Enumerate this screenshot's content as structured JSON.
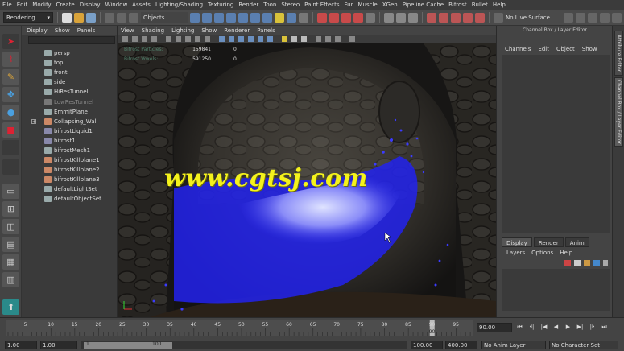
{
  "menubar": {
    "items": [
      "File",
      "Edit",
      "Modify",
      "Create",
      "Display",
      "Window",
      "Assets",
      "Lighting/Shading",
      "Texturing",
      "Render",
      "Toon",
      "Stereo",
      "Paint Effects",
      "Fur",
      "Muscle",
      "XGen",
      "Pipeline Cache",
      "Bifrost",
      "Bullet",
      "Help"
    ]
  },
  "shelf": {
    "mode_menu": "Rendering",
    "selection_mode": "Objects",
    "live_surface": "No Live Surface"
  },
  "outliner": {
    "menus": [
      "Display",
      "Show",
      "Panels"
    ],
    "items": [
      {
        "label": "persp",
        "icon": "camera-icon",
        "color": "#9aa",
        "dim": false,
        "expand": false
      },
      {
        "label": "top",
        "icon": "camera-icon",
        "color": "#9aa",
        "dim": false,
        "expand": false
      },
      {
        "label": "front",
        "icon": "camera-icon",
        "color": "#9aa",
        "dim": false,
        "expand": false
      },
      {
        "label": "side",
        "icon": "camera-icon",
        "color": "#9aa",
        "dim": false,
        "expand": false
      },
      {
        "label": "HiResTunnel",
        "icon": "mesh-icon",
        "color": "#9aa",
        "dim": false,
        "expand": false
      },
      {
        "label": "LowResTunnel",
        "icon": "mesh-icon",
        "color": "#777",
        "dim": true,
        "expand": false
      },
      {
        "label": "EmmitPlane",
        "icon": "mesh-icon",
        "color": "#9aa",
        "dim": false,
        "expand": false
      },
      {
        "label": "Collapsing_Wall",
        "icon": "group-icon",
        "color": "#c86",
        "dim": false,
        "expand": true
      },
      {
        "label": "bifrostLiquid1",
        "icon": "liquid-icon",
        "color": "#88a",
        "dim": false,
        "expand": false
      },
      {
        "label": "bifrost1",
        "icon": "bifrost-icon",
        "color": "#88a",
        "dim": false,
        "expand": false
      },
      {
        "label": "bifrostMesh1",
        "icon": "mesh-icon",
        "color": "#9aa",
        "dim": false,
        "expand": false
      },
      {
        "label": "bifrostKillplane1",
        "icon": "killplane-icon",
        "color": "#c86",
        "dim": false,
        "expand": false
      },
      {
        "label": "bifrostKillplane2",
        "icon": "killplane-icon",
        "color": "#c86",
        "dim": false,
        "expand": false
      },
      {
        "label": "bifrostKillplane3",
        "icon": "killplane-icon",
        "color": "#c86",
        "dim": false,
        "expand": false
      },
      {
        "label": "defaultLightSet",
        "icon": "set-icon",
        "color": "#9aa",
        "dim": false,
        "expand": false
      },
      {
        "label": "defaultObjectSet",
        "icon": "set-icon",
        "color": "#9aa",
        "dim": false,
        "expand": false
      }
    ]
  },
  "viewport": {
    "menus": [
      "View",
      "Shading",
      "Lighting",
      "Show",
      "Renderer",
      "Panels"
    ],
    "hud": [
      {
        "label": "Bifrost Particles:",
        "value": "159841",
        "extra": "0"
      },
      {
        "label": "Bifrost Voxels:",
        "value": "591250",
        "extra": "0"
      }
    ],
    "watermark": "www.cgtsj.com"
  },
  "channelbox": {
    "header": "Channel Box / Layer Editor",
    "menus": [
      "Channels",
      "Edit",
      "Object",
      "Show"
    ],
    "layer_tabs": [
      "Display",
      "Render",
      "Anim"
    ],
    "layer_menus": [
      "Layers",
      "Options",
      "Help"
    ]
  },
  "vtabs": [
    "Attribute Editor",
    "Channel Box / Layer Editor"
  ],
  "timeslider": {
    "ticks": [
      5,
      10,
      15,
      20,
      25,
      30,
      35,
      40,
      45,
      50,
      55,
      60,
      65,
      70,
      75,
      80,
      85,
      90,
      95
    ],
    "current_frame": "90.00",
    "playhead_label": "90",
    "playhead_frame": 90
  },
  "rangeslider": {
    "start": "1.00",
    "playback_start": "1.00",
    "range_min": "1",
    "range_max": "100",
    "playback_end": "100.00",
    "end": "400.00",
    "anim_layer": "No Anim Layer",
    "character_set": "No Character Set"
  },
  "colors": {
    "accent": "#f4f21c",
    "particles": "#2a2aff",
    "select": "#d23"
  }
}
